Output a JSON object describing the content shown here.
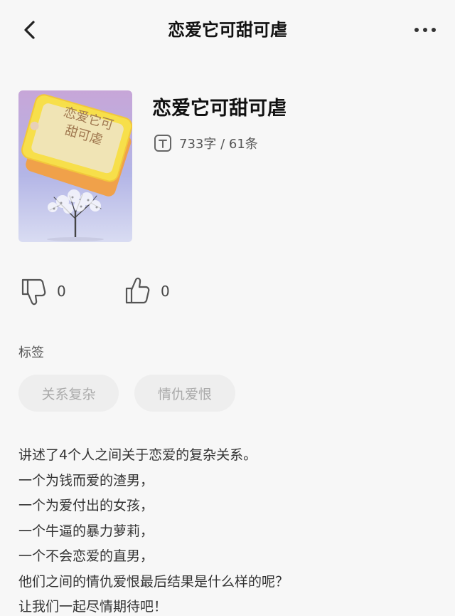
{
  "header": {
    "title": "恋爱它可甜可虐"
  },
  "book": {
    "title": "恋爱它可甜可虐",
    "cover_text_line1": "恋爱它可",
    "cover_text_line2": "甜可虐",
    "meta": "733字 / 61条"
  },
  "reactions": [
    {
      "icon": "thumbs-down-icon",
      "count": "0"
    },
    {
      "icon": "thumbs-up-icon",
      "count": "0"
    }
  ],
  "tags": {
    "label": "标签",
    "items": [
      "关系复杂",
      "情仇爱恨"
    ]
  },
  "description": [
    "讲述了4个人之间关于恋爱的复杂关系。",
    "一个为钱而爱的渣男，",
    "一个为爱付出的女孩，",
    "一个牛逼的暴力萝莉，",
    "一个不会恋爱的直男，",
    "他们之间的情仇爱恨最后结果是什么样的呢？",
    "让我们一起尽情期待吧！"
  ],
  "colors": {
    "background": "#f7f7f7",
    "tag_background": "#eeeeee",
    "tag_text": "#aaaaaa",
    "cover_tag_yellow": "#f7df4a",
    "cover_tag_orange": "#f0a14a"
  }
}
